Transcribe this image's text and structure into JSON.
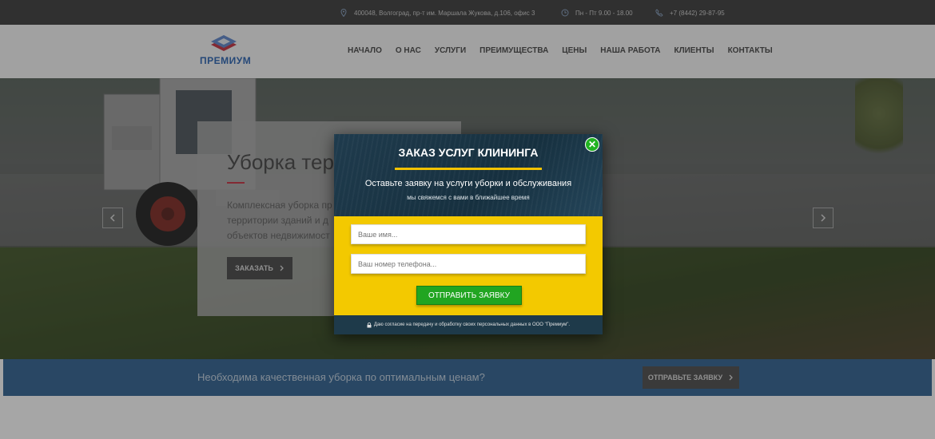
{
  "topbar": {
    "address": "400048, Волгоград, пр-т им. Маршала Жукова, д.106, офис 3",
    "hours": "Пн - Пт 9.00 - 18.00",
    "phone": "+7 (8442) 29-87-95"
  },
  "header": {
    "logo_text": "ПРЕМИУМ",
    "nav": [
      "НАЧАЛО",
      "О НАС",
      "УСЛУГИ",
      "ПРЕИМУЩЕСТВА",
      "ЦЕНЫ",
      "НАША РАБОТА",
      "КЛИЕНТЫ",
      "КОНТАКТЫ"
    ]
  },
  "hero": {
    "title": "Уборка терр",
    "description": "Комплексная уборка пр территории зданий и д объектов недвижимост",
    "button": "ЗАКАЗАТЬ"
  },
  "cta": {
    "text": "Необходима качественная уборка по оптимальным ценам?",
    "button": "ОТПРАВЬТЕ ЗАЯВКУ"
  },
  "modal": {
    "title": "ЗАКАЗ УСЛУГ КЛИНИНГА",
    "subtitle": "Оставьте заявку на услуги уборки и обслуживания",
    "subtitle2": "мы свяжемся с вами в ближайшее время",
    "name_placeholder": "Ваше имя...",
    "phone_placeholder": "Ваш номер телефона...",
    "submit": "ОТПРАВИТЬ ЗАЯВКУ",
    "consent": "Даю согласие на передачу и обработку своих персональных данных в ООО \"Премиум\".",
    "close_glyph": "✕"
  },
  "colors": {
    "accent_yellow": "#f3c900",
    "accent_green": "#21a521",
    "cta_blue": "#3f6e9a",
    "brand_blue": "#3a6fb8"
  }
}
